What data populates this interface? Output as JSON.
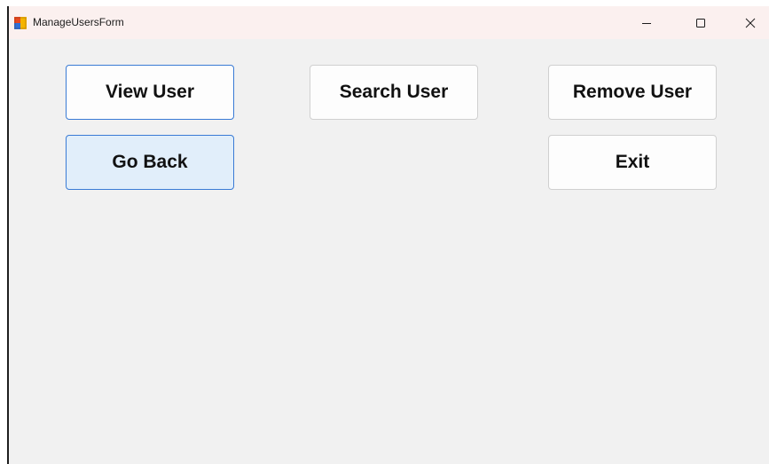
{
  "window": {
    "title": "ManageUsersForm",
    "app_icon": "winforms-app-icon",
    "controls": {
      "minimize_icon": "minimize-icon",
      "maximize_icon": "maximize-icon",
      "close_icon": "close-icon"
    }
  },
  "buttons": {
    "view_user": "View User",
    "search_user": "Search User",
    "remove_user": "Remove User",
    "go_back": "Go Back",
    "exit": "Exit"
  },
  "colors": {
    "titlebar_bg": "#fbf0ef",
    "form_bg": "#f1f1f1",
    "focus_border": "#3a7bd5",
    "hover_fill": "#e1eefa"
  }
}
